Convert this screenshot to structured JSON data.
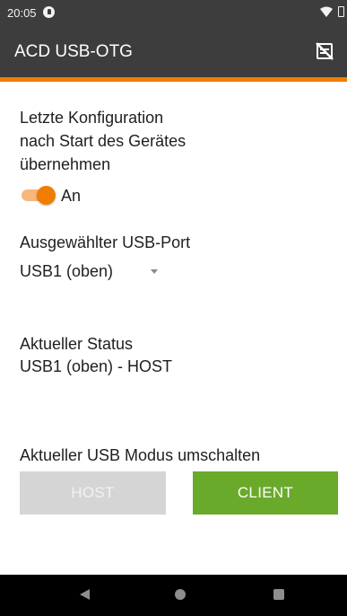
{
  "statusbar": {
    "time": "20:05"
  },
  "appbar": {
    "title": "ACD USB-OTG"
  },
  "settings": {
    "take_config_label": [
      "Letzte Konfiguration",
      "nach Start des Gerätes",
      "übernehmen"
    ],
    "take_config_switch": {
      "state_label": "An",
      "on": true
    },
    "selected_port_label": "Ausgewählter USB-Port",
    "selected_port_value": "USB1 (oben)",
    "current_status_label": "Aktueller Status",
    "current_status_value": "USB1 (oben) - HOST",
    "toggle_mode_label": "Aktueller USB Modus umschalten"
  },
  "buttons": {
    "host_label": "HOST",
    "client_label": "CLIENT"
  },
  "colors": {
    "accent": "#f07d00",
    "client_button": "#6aaa2a",
    "host_button_disabled": "#d5d5d5",
    "appbar": "#3c3d3c"
  }
}
